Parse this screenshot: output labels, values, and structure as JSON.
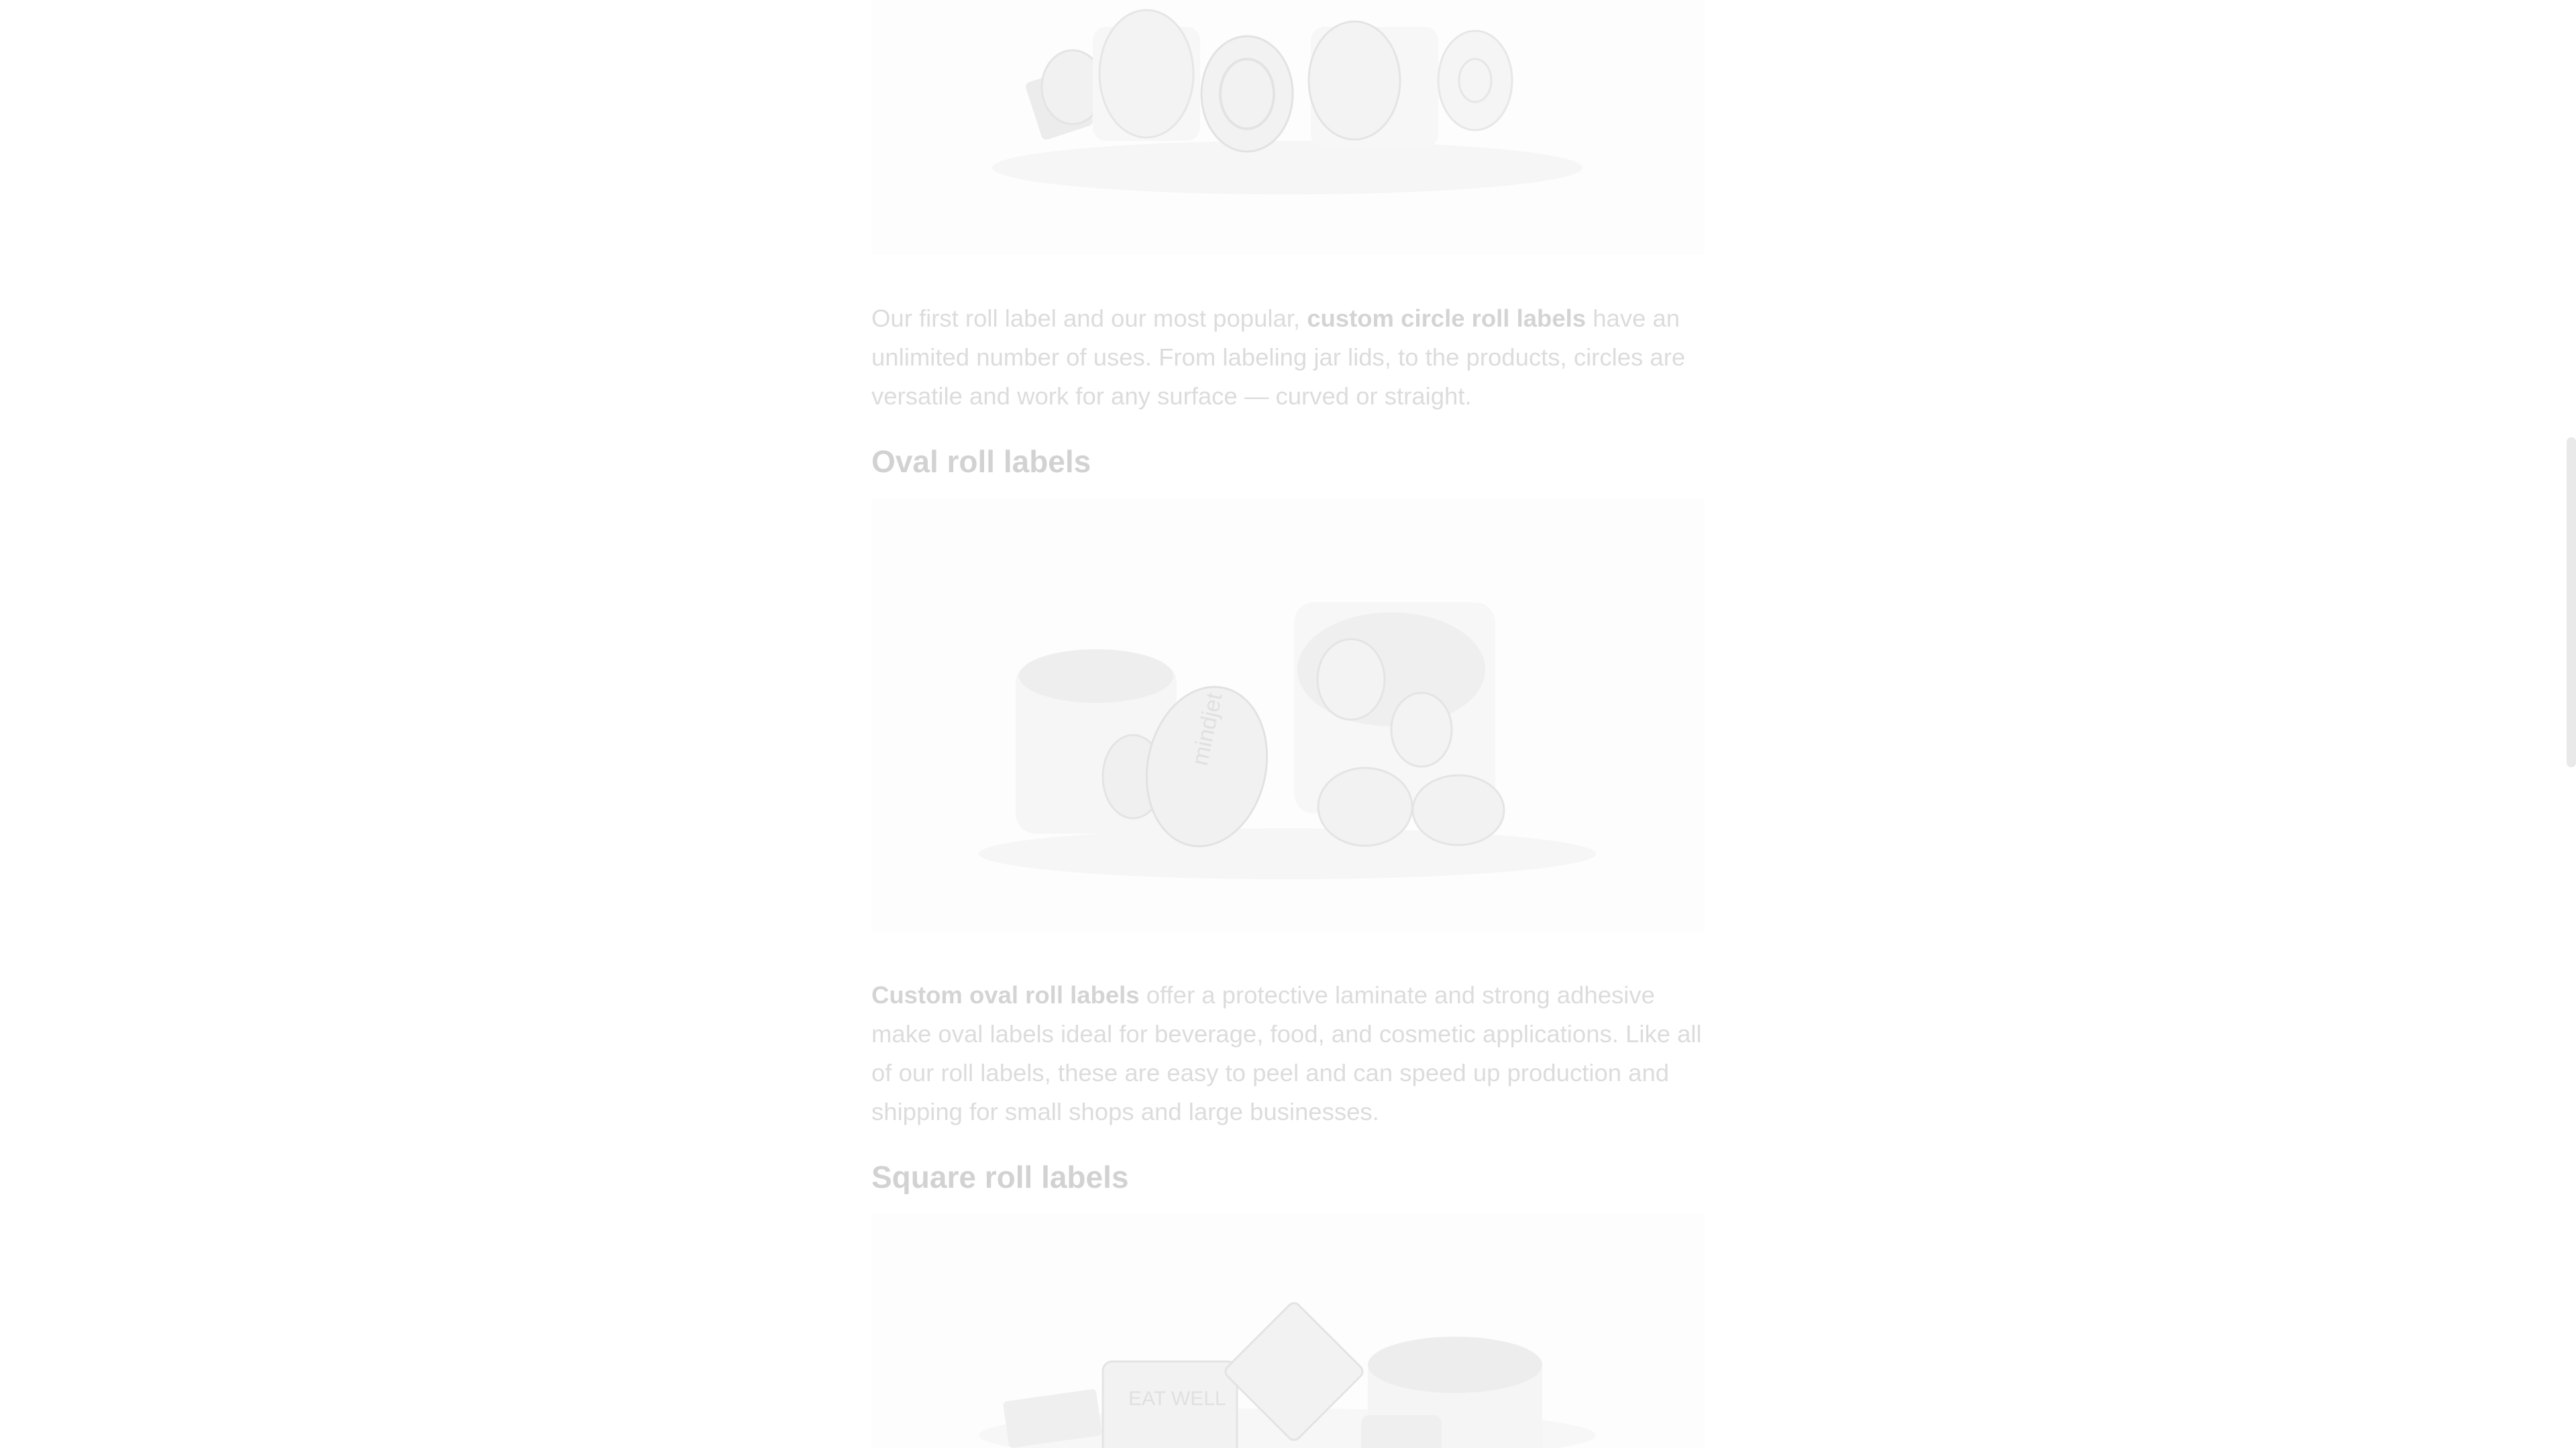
{
  "article": {
    "circle_section": {
      "paragraph": {
        "before": "Our first roll label and our most popular, ",
        "link": "custom circle roll labels",
        "after": " have an unlimited number of uses. From labeling jar lids, to the products, circles are versatile and work for any surface — curved or straight."
      }
    },
    "oval_section": {
      "heading": "Oval roll labels",
      "image_label": "mindjet",
      "paragraph": {
        "link": "Custom oval roll labels",
        "after": " offer a protective laminate and strong adhesive make oval labels ideal for beverage, food, and cosmetic applications. Like all of our roll labels, these are easy to peel and can speed up production and shipping for small shops and large businesses."
      }
    },
    "square_section": {
      "heading": "Square roll labels",
      "image_label": "EAT WELL"
    }
  },
  "colors": {
    "overlay_text": "#dcdcdc",
    "heading_text": "#d2d2d2",
    "image_bg": "#fdfdfd"
  }
}
